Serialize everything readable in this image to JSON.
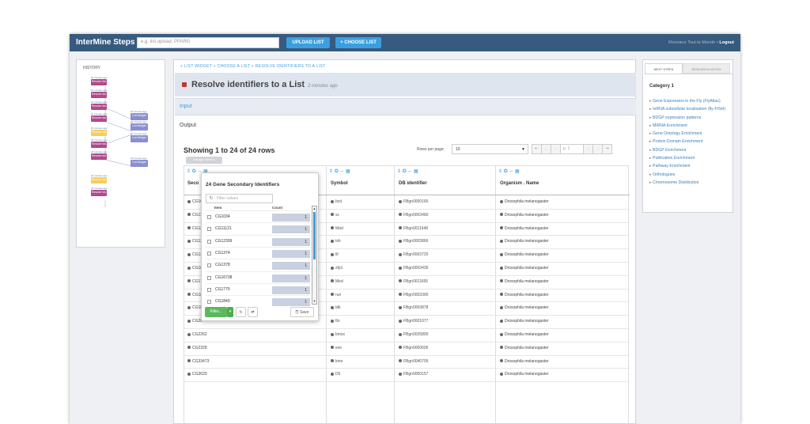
{
  "app": {
    "title": "InterMine Steps α",
    "search_placeholder": "e.g. list upload, PPARG",
    "upload_label": "UPLOAD LIST",
    "choose_label": "+ CHOOSE LIST",
    "user_name": "Monsieur Tout-le-Monde",
    "logout_label": "Logout"
  },
  "history": {
    "title": "HISTORY",
    "node_label": "Resolve Ids",
    "list_label": "List Widget",
    "node_time": "20 minutes ago"
  },
  "main": {
    "breadcrumbs": "+ LIST WIDGET  +  CHOOSE A LIST  +  RESOLVE IDENTIFIERS TO A LIST",
    "step_title": "Resolve identifiers to a List",
    "step_time": "2 minutes ago",
    "input_label": "Input",
    "output_label": "Output",
    "showing": "Showing 1 to 24 of 24 rows",
    "rows_per_page_label": "Rows per page:",
    "rows_per_page_value": "10",
    "page_value": "p. 1",
    "manage_label": "Manage columns",
    "columns": [
      "Secondary Identifier",
      "Symbol",
      "DB identifier",
      "Organism . Name"
    ],
    "col0_visible": "Seco",
    "rows": [
      {
        "sec": "CG10",
        "sym": "bcd",
        "db": "FBgn0000166",
        "org": "Drosophila melanogaster"
      },
      {
        "sec": "CG11",
        "sym": "sc",
        "db": "FBgn0003460",
        "org": "Drosophila melanogaster"
      },
      {
        "sec": "CG12",
        "sym": "Mad",
        "db": "FBgn0011648",
        "org": "Drosophila melanogaster"
      },
      {
        "sec": "CG13",
        "sym": "tsh",
        "db": "FBgn0003866",
        "org": "Drosophila melanogaster"
      },
      {
        "sec": "CG13",
        "sym": "tll",
        "db": "FBgn0003720",
        "org": "Drosophila melanogaster"
      },
      {
        "sec": "CG16",
        "sym": "zfp1",
        "db": "FBgn0003436",
        "org": "Drosophila melanogaster"
      },
      {
        "sec": "CG17",
        "sym": "Med",
        "db": "FBgn0011655",
        "org": "Drosophila melanogaster"
      },
      {
        "sec": "CG18",
        "sym": "run",
        "db": "FBgn0003300",
        "org": "Drosophila melanogaster"
      },
      {
        "sec": "CG18",
        "sym": "tdk",
        "db": "FBgn0003878",
        "org": "Drosophila melanogaster"
      },
      {
        "sec": "CG20",
        "sym": "fto",
        "db": "FBgn0001077",
        "org": "Drosophila melanogaster"
      },
      {
        "sec": "CG2262",
        "sym": "bmsx",
        "db": "FBgn0025800",
        "org": "Drosophila melanogaster"
      },
      {
        "sec": "CG2328",
        "sym": "eve",
        "db": "FBgn0000606",
        "org": "Drosophila melanogaster"
      },
      {
        "sec": "CG33473",
        "sym": "kmo",
        "db": "FBgn0040705",
        "org": "Drosophila melanogaster"
      },
      {
        "sec": "CG3629",
        "sym": "Dll",
        "db": "FBgn0000157",
        "org": "Drosophila melanogaster"
      }
    ]
  },
  "popup": {
    "title": "24 Gene Secondary Identifiers",
    "filter_placeholder": "Filter values",
    "col_item": "Item",
    "col_count": "Count",
    "items": [
      {
        "item": "CG1034",
        "count": "1"
      },
      {
        "item": "CG11121",
        "count": "1"
      },
      {
        "item": "CG12399",
        "count": "1"
      },
      {
        "item": "CG1374",
        "count": "1"
      },
      {
        "item": "CG1378",
        "count": "1"
      },
      {
        "item": "CG16738",
        "count": "1"
      },
      {
        "item": "CG1775",
        "count": "1"
      },
      {
        "item": "CG1849",
        "count": "1"
      }
    ],
    "filter_btn": "Filter...",
    "save_btn": "Save"
  },
  "next_steps": {
    "tab_next": "NEXT STEPS",
    "tab_research": "RESEARCH NOTES",
    "category": "Category 1",
    "items": [
      "Gene Expression in the Fly (FlyAtlas)",
      "mRNA subcellular localisation (fly-FISH)",
      "BDGP expression patterns",
      "MiRNA Enrichment",
      "Gene Ontology Enrichment",
      "Protein Domain Enrichment",
      "BDGP Enrichment",
      "Publication Enrichment",
      "Pathway Enrichment",
      "Orthologues",
      "Chromosome Distribution"
    ]
  },
  "colors": {
    "navbar": "#375a7f",
    "accent": "#3b9fdf",
    "history_node": "#b04a8c",
    "history_highlight": "#f4cf5a",
    "list_node": "#8a8fcf",
    "filter_green": "#5cb85c"
  }
}
